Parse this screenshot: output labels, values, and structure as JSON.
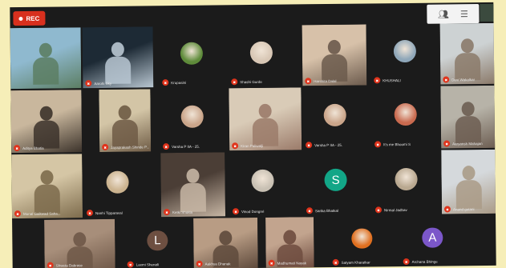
{
  "recording": {
    "label": "REC"
  },
  "tile_icon": "mic-muted-icon",
  "tiles": [
    {
      "id": "t1",
      "label": "",
      "c1": "#8fb9cf",
      "c2": "#5c7e63"
    },
    {
      "id": "t2",
      "label": "Aarohi Sky",
      "c1": "#1d2a35",
      "c2": "#b9c7d2"
    },
    {
      "id": "t3",
      "label": "Krupasini",
      "avatar": "#5e8b3a"
    },
    {
      "id": "t4",
      "label": "Shashi Gurde",
      "avatar": "#d8c7b5"
    },
    {
      "id": "t5",
      "label": "Harshita Dalal",
      "c1": "#d7c1a9",
      "c2": "#6b5a4c"
    },
    {
      "id": "t6",
      "label": "KHUSHALI",
      "avatar": "#8fa7b9"
    },
    {
      "id": "t7",
      "label": "Devi Wakalkar",
      "c1": "#cdd2d3",
      "c2": "#8b7a6a"
    },
    {
      "id": "t8",
      "label": "Aditya Bhatia",
      "c1": "#c9b79d",
      "c2": "#3c332b"
    },
    {
      "id": "t9",
      "label": "Jayaprakash Shinde P...",
      "c1": "#d3c5a6",
      "c2": "#6e5b45"
    },
    {
      "id": "t10",
      "label": "Varsha P IIA - 25.",
      "avatar": "#caa58a"
    },
    {
      "id": "t11",
      "label": "Kiran Paliwalji",
      "c1": "#d9cbb7",
      "c2": "#9b7b6a"
    },
    {
      "id": "t12",
      "label": "Varsha P IIA - 25.",
      "avatar": "#caa58a"
    },
    {
      "id": "t13",
      "label": "It's me Bhoomi S",
      "avatar": "#c96a4f"
    },
    {
      "id": "t14",
      "label": "Aaryansh Mahajan",
      "c1": "#b7b3a8",
      "c2": "#6d5e52"
    },
    {
      "id": "t15",
      "label": "Monal Gaikwad Saha...",
      "c1": "#d5c6a5",
      "c2": "#7d6b4c"
    },
    {
      "id": "t16",
      "label": "Nanhi Tipparaval",
      "avatar": "#cbb38f"
    },
    {
      "id": "t17",
      "label": "Ketki Shukla",
      "c1": "#4b3e36",
      "c2": "#c7b6a4"
    },
    {
      "id": "t18",
      "label": "Vinod Dongrel",
      "avatar": "#c8c0b3"
    },
    {
      "id": "t19",
      "label": "Sarika Bhatkal",
      "letter": "S",
      "color": "#12a687"
    },
    {
      "id": "t20",
      "label": "Nirmal Jadhav",
      "avatar": "#b9a890"
    },
    {
      "id": "t21",
      "label": "Anand gotani",
      "c1": "#d5d9dc",
      "c2": "#aa9b87"
    },
    {
      "id": "t22",
      "label": "Shweta Dabrase",
      "c1": "#a78e7a",
      "c2": "#6f5848"
    },
    {
      "id": "t23",
      "label": "Laxmi Shenali",
      "letter": "L",
      "color": "#6d4f41"
    },
    {
      "id": "t24",
      "label": "Aakhya Dhanak",
      "c1": "#b89c84",
      "c2": "#5e4a3c"
    },
    {
      "id": "t25",
      "label": "Madhumati Nayak",
      "c1": "#c2a48e",
      "c2": "#6e4c3f"
    },
    {
      "id": "t26",
      "label": "Satyam Kharatkar",
      "avatar": "#e06f1f"
    },
    {
      "id": "t27",
      "label": "Archana Bhinge",
      "letter": "A",
      "color": "#7b57c9"
    }
  ]
}
